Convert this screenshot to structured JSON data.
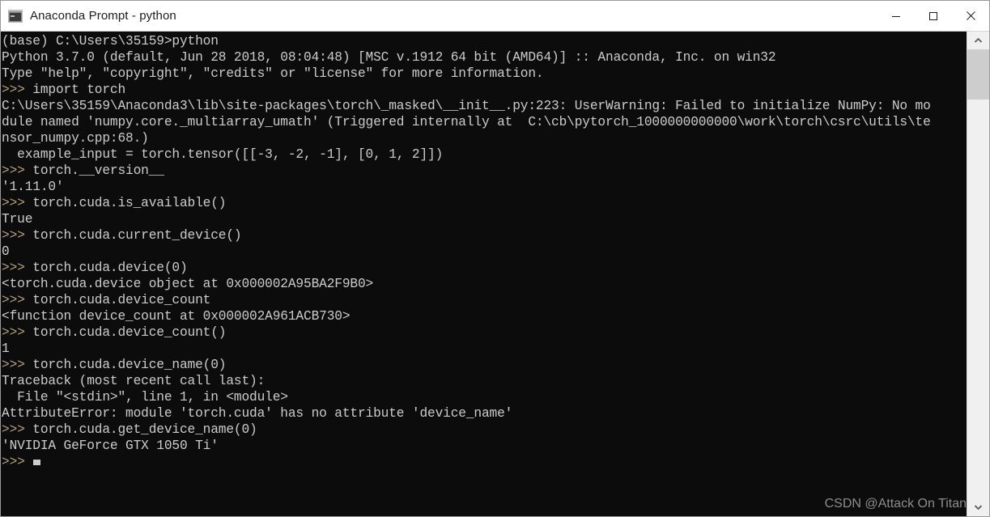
{
  "window": {
    "title": "Anaconda Prompt - python",
    "icon": "console-icon",
    "controls": {
      "minimize": "minimize-icon",
      "maximize": "maximize-icon",
      "close": "close-icon"
    }
  },
  "theme": {
    "console_bg": "#0c0c0c",
    "console_fg": "#cccccc",
    "prompt_fg": "#b5a07a",
    "titlebar_bg": "#ffffff",
    "titlebar_fg": "#1d1d1d",
    "scrollbar_track": "#f0f0f0",
    "scrollbar_thumb": "#cdcdcd"
  },
  "terminal": {
    "prompt_symbol": ">>> ",
    "cursor": "block-cursor",
    "lines": [
      {
        "type": "output",
        "text": "(base) C:\\Users\\35159>python"
      },
      {
        "type": "output",
        "text": "Python 3.7.0 (default, Jun 28 2018, 08:04:48) [MSC v.1912 64 bit (AMD64)] :: Anaconda, Inc. on win32"
      },
      {
        "type": "output",
        "text": "Type \"help\", \"copyright\", \"credits\" or \"license\" for more information."
      },
      {
        "type": "input",
        "prompt": ">>> ",
        "text": "import torch"
      },
      {
        "type": "output",
        "text": "C:\\Users\\35159\\Anaconda3\\lib\\site-packages\\torch\\_masked\\__init__.py:223: UserWarning: Failed to initialize NumPy: No mo"
      },
      {
        "type": "output",
        "text": "dule named 'numpy.core._multiarray_umath' (Triggered internally at  C:\\cb\\pytorch_1000000000000\\work\\torch\\csrc\\utils\\te"
      },
      {
        "type": "output",
        "text": "nsor_numpy.cpp:68.)"
      },
      {
        "type": "output",
        "text": "  example_input = torch.tensor([[-3, -2, -1], [0, 1, 2]])"
      },
      {
        "type": "input",
        "prompt": ">>> ",
        "text": "torch.__version__"
      },
      {
        "type": "output",
        "text": "'1.11.0'"
      },
      {
        "type": "input",
        "prompt": ">>> ",
        "text": "torch.cuda.is_available()"
      },
      {
        "type": "output",
        "text": "True"
      },
      {
        "type": "input",
        "prompt": ">>> ",
        "text": "torch.cuda.current_device()"
      },
      {
        "type": "output",
        "text": "0"
      },
      {
        "type": "input",
        "prompt": ">>> ",
        "text": "torch.cuda.device(0)"
      },
      {
        "type": "output",
        "text": "<torch.cuda.device object at 0x000002A95BA2F9B0>"
      },
      {
        "type": "input",
        "prompt": ">>> ",
        "text": "torch.cuda.device_count"
      },
      {
        "type": "output",
        "text": "<function device_count at 0x000002A961ACB730>"
      },
      {
        "type": "input",
        "prompt": ">>> ",
        "text": "torch.cuda.device_count()"
      },
      {
        "type": "output",
        "text": "1"
      },
      {
        "type": "input",
        "prompt": ">>> ",
        "text": "torch.cuda.device_name(0)"
      },
      {
        "type": "output",
        "text": "Traceback (most recent call last):"
      },
      {
        "type": "output",
        "text": "  File \"<stdin>\", line 1, in <module>"
      },
      {
        "type": "output",
        "text": "AttributeError: module 'torch.cuda' has no attribute 'device_name'"
      },
      {
        "type": "input",
        "prompt": ">>> ",
        "text": "torch.cuda.get_device_name(0)"
      },
      {
        "type": "output",
        "text": "'NVIDIA GeForce GTX 1050 Ti'"
      },
      {
        "type": "cursor-line",
        "prompt": ">>> ",
        "text": ""
      }
    ]
  },
  "watermark": {
    "text": "CSDN @Attack On Titan"
  },
  "scrollbar": {
    "up_arrow": "chevron-up-icon",
    "down_arrow": "chevron-down-icon"
  }
}
